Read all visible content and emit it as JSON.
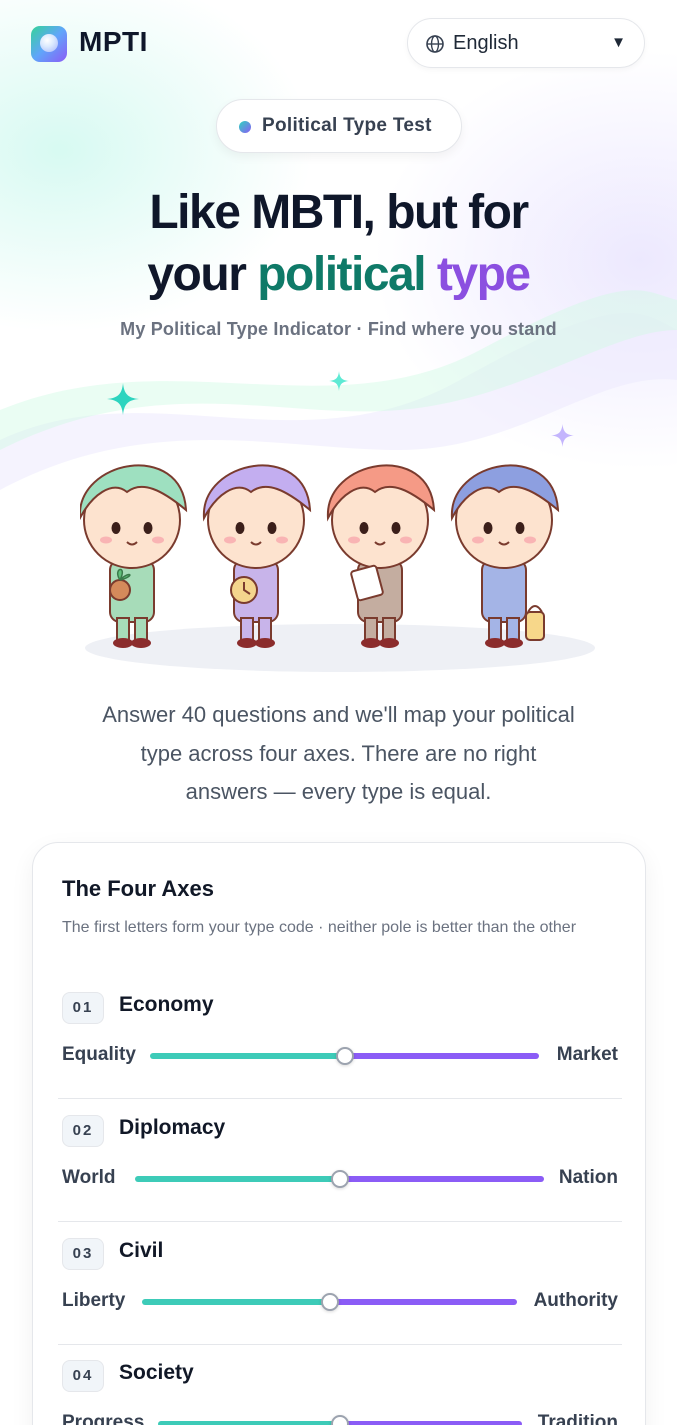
{
  "header": {
    "brand": "MPTI",
    "language": {
      "selected": "English",
      "icon": "globe-icon",
      "caret_icon": "chevron-down-icon"
    }
  },
  "hero": {
    "badge": "Political Type Test",
    "headline": {
      "line1": "Like MBTI, but for",
      "line2_lead": "your",
      "word_green": "political",
      "word_purple": "type"
    },
    "subtitle": "My Political Type Indicator · Find where you stand",
    "illustration": "four-characters-illustration",
    "intro": "Answer 40 questions and we'll map your political type across four axes. There are no right answers — every type is equal."
  },
  "axes_card": {
    "title": "The Four Axes",
    "subtitle": "The first letters form your type code · neither pole is better than the other",
    "axes": [
      {
        "num": "01",
        "name": "Economy",
        "left": "Equality",
        "right": "Market",
        "position": 0.5
      },
      {
        "num": "02",
        "name": "Diplomacy",
        "left": "World",
        "right": "Nation",
        "position": 0.5
      },
      {
        "num": "03",
        "name": "Civil",
        "left": "Liberty",
        "right": "Authority",
        "position": 0.5
      },
      {
        "num": "04",
        "name": "Society",
        "left": "Progress",
        "right": "Tradition",
        "position": 0.5
      }
    ]
  },
  "colors": {
    "accent_green": "#0f7a68",
    "accent_purple": "#8b4fe0",
    "track_left": "#3dcbb8",
    "track_right": "#8b5cf6"
  }
}
